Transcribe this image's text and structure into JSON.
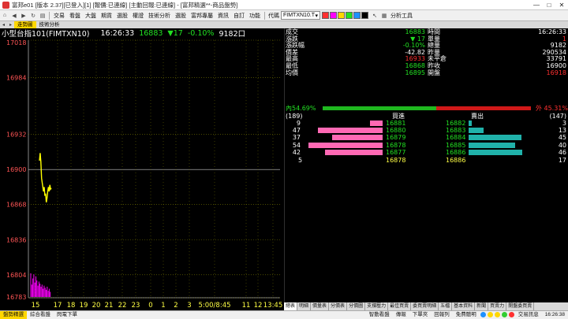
{
  "window": {
    "title": "富邦e01 [版本 2.37][已登入][1] [報價:已連線] [主動回報:已連線] - [富邦精選**-商品盤勢]",
    "controls": [
      "—",
      "□",
      "✕"
    ]
  },
  "toolbar": {
    "menus": [
      "交易",
      "看盤",
      "大盤",
      "期貨",
      "選股",
      "權證",
      "技術分析",
      "選股",
      "富邦專屬",
      "資訊",
      "自訂",
      "功能"
    ],
    "code_label": "代碼",
    "code_value": "FIMTXN10.T",
    "analysis_label": "分析工具"
  },
  "tabs": {
    "items": [
      "走勢圖",
      "技術分析"
    ],
    "active_index": 0
  },
  "chart_header": {
    "symbol": "小型台指101(FIMTXN10)",
    "time": "16:26:33",
    "price": "16883",
    "change": "▼17",
    "percent": "-0.10%",
    "volume": "9182口"
  },
  "chart_data": {
    "type": "line",
    "title": "",
    "y_ticks": [
      17018,
      16984,
      16932,
      16900,
      16868,
      16836,
      16804,
      16783
    ],
    "x_ticks": [
      "15",
      "17",
      "18",
      "19",
      "20",
      "21",
      "22",
      "23",
      "0",
      "1",
      "2",
      "3",
      "5:00/8:45",
      "11",
      "12",
      "13:45"
    ],
    "ylim": [
      16783,
      17018
    ],
    "reference_price": 16900,
    "series": [
      {
        "values": [
          16908,
          16915,
          16907,
          16892,
          16880,
          16884,
          16876,
          16878,
          16870,
          16874,
          16880,
          16884,
          16880,
          16886,
          16882,
          16883
        ]
      }
    ],
    "volume_bars": [
      23,
      12,
      18,
      22,
      14,
      20,
      16,
      11,
      15,
      13,
      10,
      12,
      8,
      11,
      9,
      7,
      10,
      6,
      8,
      5
    ],
    "colors": {
      "price_line": "#ffff00",
      "volume": "#ff00ff",
      "grid": "#7a7a00"
    }
  },
  "quote": {
    "left": [
      {
        "label": "成交",
        "value": "16883",
        "color": "green"
      },
      {
        "label": "漲跌",
        "value": "▼ 17",
        "color": "green"
      },
      {
        "label": "漲跌幅",
        "value": "-0.10%",
        "color": "green"
      },
      {
        "label": "價差",
        "value": "-42.82",
        "color": "white"
      },
      {
        "label": "最高",
        "value": "16933",
        "color": "red"
      },
      {
        "label": "最低",
        "value": "16868",
        "color": "green"
      },
      {
        "label": "均價",
        "value": "16895",
        "color": "green"
      }
    ],
    "right": [
      {
        "label": "時間",
        "value": "16:26:33",
        "color": "white"
      },
      {
        "label": "單量",
        "value": "1",
        "color": "red"
      },
      {
        "label": "總量",
        "value": "9182",
        "color": "white"
      },
      {
        "label": "昨量",
        "value": "290534",
        "color": "white"
      },
      {
        "label": "未平倉",
        "value": "33791",
        "color": "white"
      },
      {
        "label": "昨收",
        "value": "16900",
        "color": "white"
      },
      {
        "label": "開盤",
        "value": "16918",
        "color": "red"
      }
    ],
    "ratio": {
      "bid_pct_text": "內54.69%",
      "ask_pct_text": "外 45.31%",
      "bid_fraction": 0.5469
    },
    "depth_header": {
      "bid_total": "(189)",
      "bid_label": "買進",
      "ask_label": "賣出",
      "ask_total": "(147)"
    },
    "depth": [
      {
        "bid_qty": "9",
        "bid_price": "16881",
        "ask_price": "16882",
        "ask_qty": "3",
        "bid_bar": 9,
        "ask_bar": 3
      },
      {
        "bid_qty": "47",
        "bid_price": "16880",
        "ask_price": "16883",
        "ask_qty": "13",
        "bid_bar": 47,
        "ask_bar": 13
      },
      {
        "bid_qty": "37",
        "bid_price": "16879",
        "ask_price": "16884",
        "ask_qty": "45",
        "bid_bar": 37,
        "ask_bar": 45
      },
      {
        "bid_qty": "54",
        "bid_price": "16878",
        "ask_price": "16885",
        "ask_qty": "40",
        "bid_bar": 54,
        "ask_bar": 40
      },
      {
        "bid_qty": "42",
        "bid_price": "16877",
        "ask_price": "16886",
        "ask_qty": "46",
        "bid_bar": 42,
        "ask_bar": 46
      }
    ],
    "totals": {
      "bid_count": "5",
      "bid_price": "16878",
      "ask_price": "16886",
      "ask_count": "17"
    }
  },
  "chart_tabs": [
    "總表",
    "明細",
    "價量表",
    "分價表",
    "分價圖",
    "支撐壓力",
    "最佳買賣",
    "委買賣明細",
    "五檔",
    "基本資料",
    "新聞",
    "買賣力",
    "開盤委買賣"
  ],
  "statusbar": {
    "items": [
      "盤勢精選",
      "綜合看盤",
      "閃電下單"
    ],
    "right_items": [
      "智動看盤",
      "傳報",
      "下單夾",
      "回報列",
      "免費聽明",
      "交易訊息"
    ],
    "clock": "16:26:38",
    "colors": [
      "#1e90ff",
      "#ffd700",
      "#ffd700",
      "#32cd32",
      "#ff3030"
    ]
  }
}
